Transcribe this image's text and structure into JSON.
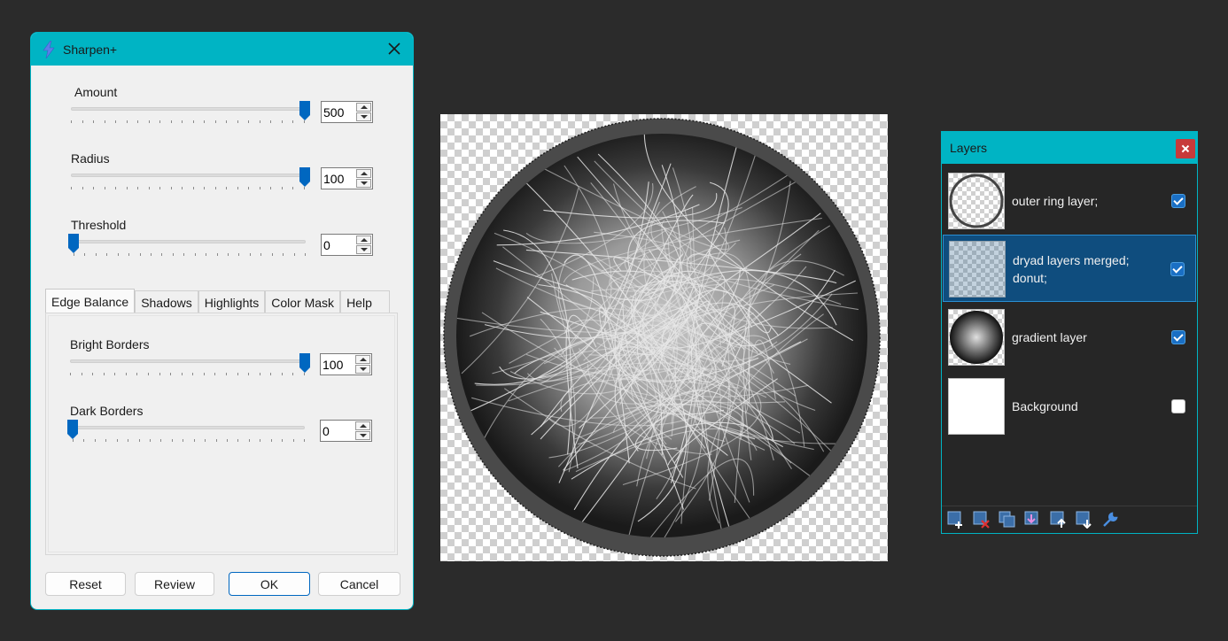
{
  "dialog": {
    "title": "Sharpen+",
    "app_icon": "lightning-bolt-icon",
    "close_icon": "close-icon",
    "sliders": [
      {
        "label": "Amount",
        "value": "500",
        "fraction": 1.0
      },
      {
        "label": "Radius",
        "value": "100",
        "fraction": 1.0
      },
      {
        "label": "Threshold",
        "value": "0",
        "fraction": 0.0
      }
    ],
    "tabs": [
      "Edge Balance",
      "Shadows",
      "Highlights",
      "Color Mask",
      "Help"
    ],
    "active_tab": "Edge Balance",
    "edge_balance": [
      {
        "label": "Bright Borders",
        "value": "100",
        "fraction": 1.0
      },
      {
        "label": "Dark Borders",
        "value": "0",
        "fraction": 0.0
      }
    ],
    "buttons": {
      "reset": "Reset",
      "review": "Review",
      "ok": "OK",
      "cancel": "Cancel"
    }
  },
  "layers": {
    "title": "Layers",
    "items": [
      {
        "name": "outer ring layer;",
        "visible": true,
        "selected": false
      },
      {
        "name": "dryad layers merged;",
        "name2": "donut;",
        "visible": true,
        "selected": true
      },
      {
        "name": "gradient layer",
        "visible": true,
        "selected": false
      },
      {
        "name": "Background",
        "visible": false,
        "selected": false
      }
    ],
    "toolbar_icons": [
      "add-layer-icon",
      "delete-layer-icon",
      "duplicate-layer-icon",
      "merge-layer-down-icon",
      "move-layer-up-icon",
      "move-layer-down-icon",
      "layer-properties-icon"
    ]
  },
  "colors": {
    "accent": "#00b4c4",
    "slider_thumb": "#0067c0",
    "selected_layer": "#0f4d7e",
    "background": "#2b2b2b"
  }
}
